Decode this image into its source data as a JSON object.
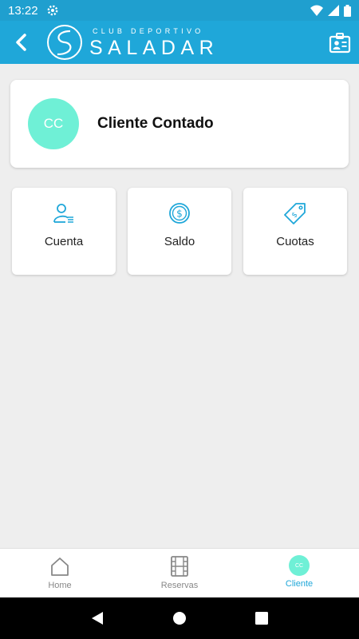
{
  "status_bar": {
    "time": "13:22"
  },
  "header": {
    "logo_top": "CLUB DEPORTIVO",
    "logo_name": "SALADAR"
  },
  "client": {
    "initials": "CC",
    "name": "Cliente Contado"
  },
  "tiles": [
    {
      "label": "Cuenta",
      "icon": "user-list-icon"
    },
    {
      "label": "Saldo",
      "icon": "dollar-coin-icon"
    },
    {
      "label": "Cuotas",
      "icon": "price-tag-icon"
    }
  ],
  "bottom_nav": {
    "items": [
      {
        "label": "Home",
        "icon": "home-icon"
      },
      {
        "label": "Reservas",
        "icon": "film-strip-icon"
      },
      {
        "label": "Cliente",
        "icon": "avatar",
        "initials": "CC",
        "active": true
      }
    ]
  },
  "colors": {
    "primary": "#1fa7d9",
    "accent": "#6ff0d6",
    "background": "#eeeeee"
  }
}
